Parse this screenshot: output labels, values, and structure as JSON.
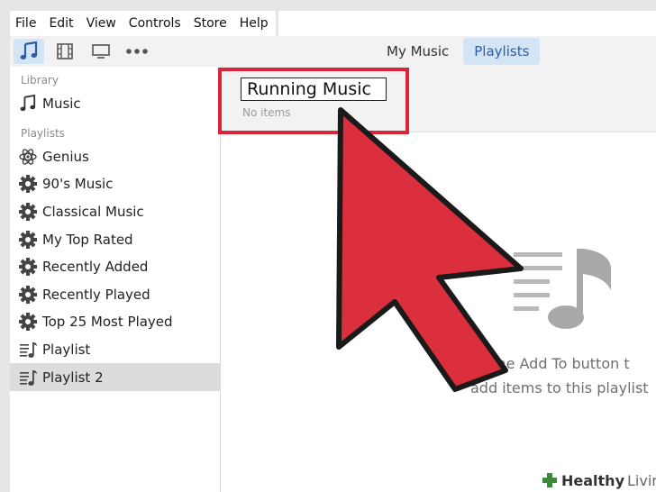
{
  "menu": [
    "File",
    "Edit",
    "View",
    "Controls",
    "Store",
    "Help"
  ],
  "toolbar": {
    "media_buttons": [
      "music-note-icon",
      "film-icon",
      "monitor-icon",
      "more-icon"
    ],
    "tabs": [
      {
        "label": "My Music",
        "active": false
      },
      {
        "label": "Playlists",
        "active": true
      }
    ]
  },
  "sidebar": {
    "library_label": "Library",
    "library_items": [
      {
        "label": "Music",
        "icon": "music-note-icon"
      }
    ],
    "playlists_label": "Playlists",
    "playlist_items": [
      {
        "label": "Genius",
        "icon": "atom-icon"
      },
      {
        "label": "90's Music",
        "icon": "gear-icon"
      },
      {
        "label": "Classical Music",
        "icon": "gear-icon"
      },
      {
        "label": "My Top Rated",
        "icon": "gear-icon"
      },
      {
        "label": "Recently Added",
        "icon": "gear-icon"
      },
      {
        "label": "Recently Played",
        "icon": "gear-icon"
      },
      {
        "label": "Top 25 Most Played",
        "icon": "gear-icon"
      },
      {
        "label": "Playlist",
        "icon": "playlist-icon"
      },
      {
        "label": "Playlist 2",
        "icon": "playlist-icon",
        "selected": true
      }
    ]
  },
  "main": {
    "playlist_name_value": "Running Music",
    "no_items": "No items",
    "empty_line1": "ck the Add To button t",
    "empty_line2": "add items to this playlist"
  },
  "watermark": {
    "bold": "Healthy",
    "light": "Living"
  },
  "colors": {
    "accent": "#2a5ea8",
    "tab_active_bg": "#d3e4f5",
    "highlight": "#d9243a",
    "arrow_fill": "#dc2f3e"
  }
}
